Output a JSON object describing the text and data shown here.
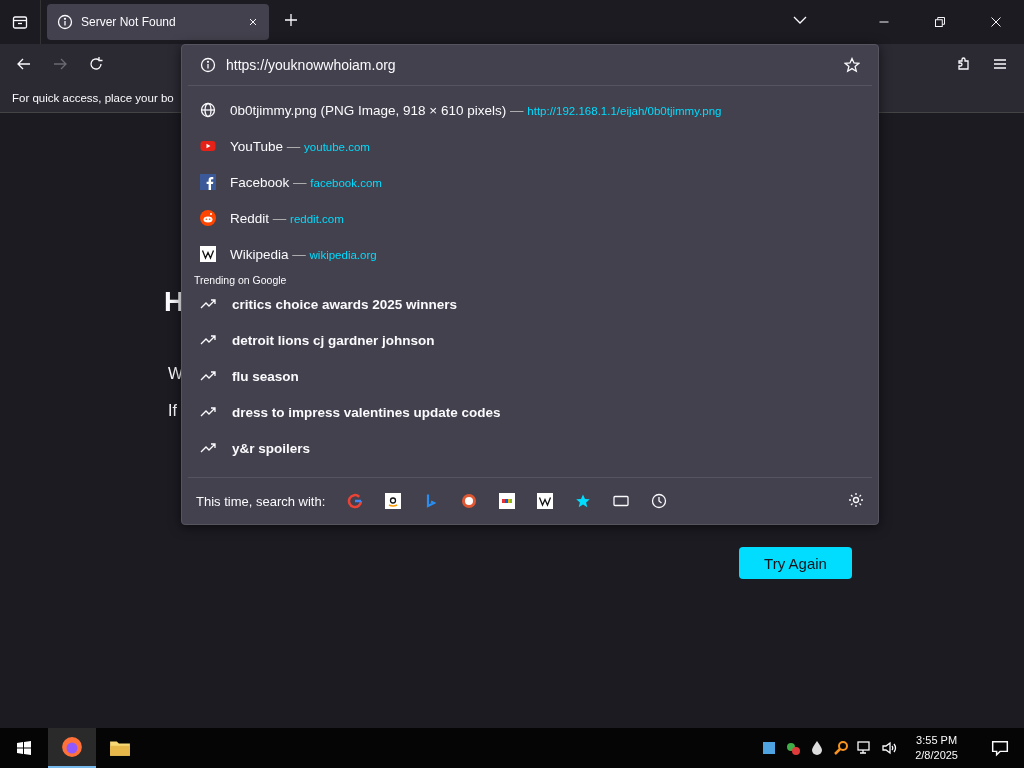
{
  "tab": {
    "title": "Server Not Found",
    "selected": true
  },
  "url_field": {
    "value": "https://youknowwhoiam.org"
  },
  "bookmarks_bar": {
    "hint": "For quick access, place your bo"
  },
  "page": {
    "heading": "H",
    "line_1": "W",
    "line_2": "If",
    "button": "Try Again"
  },
  "suggestions": [
    {
      "kind": "file",
      "title": "0b0tjimmy.png (PNG Image, 918 × 610 pixels)",
      "separator": "—",
      "url": "http://192.168.1.1/eijah/0b0tjimmy.png"
    },
    {
      "kind": "youtube",
      "title": "YouTube",
      "separator": "—",
      "url": "youtube.com"
    },
    {
      "kind": "facebook",
      "title": "Facebook",
      "separator": "—",
      "url": "facebook.com"
    },
    {
      "kind": "reddit",
      "title": "Reddit",
      "separator": "—",
      "url": "reddit.com"
    },
    {
      "kind": "wikipedia",
      "title": "Wikipedia",
      "separator": "—",
      "url": "wikipedia.org"
    }
  ],
  "trending": {
    "heading": "Trending on Google",
    "items": [
      "critics choice awards 2025 winners",
      "detroit lions cj gardner johnson",
      "flu season",
      "dress to impress valentines update codes",
      "y&r spoilers"
    ]
  },
  "search_with": {
    "label": "This time, search with:"
  },
  "taskbar": {
    "time": "3:55 PM",
    "date": "2/8/2025"
  }
}
